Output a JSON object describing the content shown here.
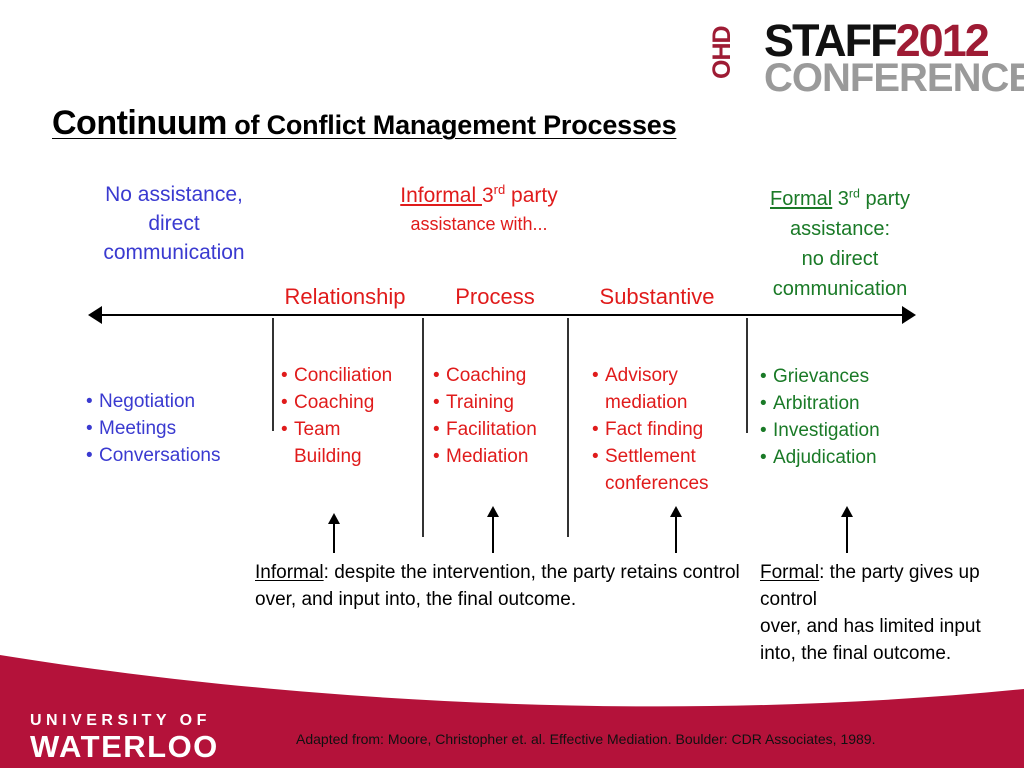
{
  "logo": {
    "ohd": "OHD",
    "staff": "STAFF",
    "year": "2012",
    "conference": "CONFERENCE"
  },
  "title": {
    "main": "Continuum",
    "sub": " of Conflict Management Processes"
  },
  "headers": {
    "left": "No assistance,\ndirect\ncommunication",
    "middle": {
      "underlined": "Informal ",
      "rest_line1": "3",
      "sup": "rd",
      "rest_line1_tail": " party",
      "line2": "assistance with..."
    },
    "right": {
      "underlined": "Formal",
      "rest_line1": " 3",
      "sup": "rd",
      "rest_line1_tail": " party",
      "line2": "assistance:",
      "line3": "no direct",
      "line4": "communication"
    }
  },
  "categories": {
    "relationship": "Relationship",
    "process": "Process",
    "substantive": "Substantive"
  },
  "columns": {
    "negotiation": [
      "Negotiation",
      "Meetings",
      "Conversations"
    ],
    "relationship": [
      "Conciliation",
      "Coaching",
      "Team\nBuilding"
    ],
    "process": [
      "Coaching",
      "Training",
      "Facilitation",
      "Mediation"
    ],
    "substantive": [
      "Advisory\nmediation",
      "Fact finding",
      "Settlement\nconferences"
    ],
    "formal": [
      "Grievances",
      "Arbitration",
      "Investigation",
      "Adjudication"
    ]
  },
  "captions": {
    "informal_label": "Informal",
    "informal_text": ": despite the intervention, the party retains control over, and input into, the final outcome.",
    "formal_label": "Formal",
    "formal_text": ": the party gives up control\nover, and has limited input into, the final outcome."
  },
  "footer": {
    "university_line1": "UNIVERSITY OF",
    "university_line2": "WATERLOO",
    "attribution": "Adapted from: Moore, Christopher et. al. Effective Mediation.  Boulder: CDR Associates, 1989."
  },
  "colors": {
    "blue": "#3a3ad0",
    "red": "#e01b1b",
    "green": "#1a7a27",
    "banner_red": "#b4123a",
    "logo_maroon": "#9e1b34"
  }
}
